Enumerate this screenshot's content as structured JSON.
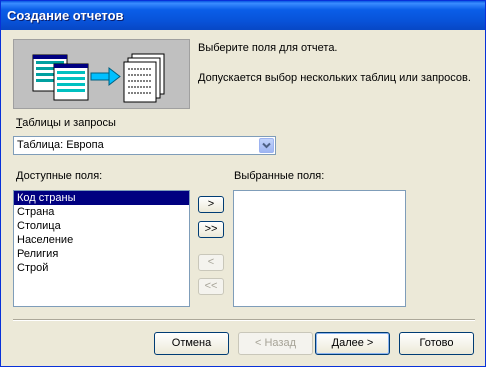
{
  "window": {
    "title": "Создание отчетов"
  },
  "intro": {
    "line1": "Выберите поля для отчета.",
    "line2": "Допускается выбор нескольких таблиц или запросов."
  },
  "tables_queries": {
    "label_mnemonic": "Т",
    "label_rest": "аблицы и запросы",
    "selected": "Таблица: Европа"
  },
  "available_fields": {
    "label_mnemonic": "Д",
    "label_rest": "оступные поля:",
    "items": [
      "Код страны",
      "Страна",
      "Столица",
      "Население",
      "Религия",
      "Строй"
    ],
    "selected_index": 0
  },
  "selected_fields": {
    "label": "Выбранные поля:",
    "items": []
  },
  "move_buttons": {
    "add_one": ">",
    "add_all": ">>",
    "remove_one": "<",
    "remove_all": "<<"
  },
  "footer": {
    "cancel": "Отмена",
    "back": "< Назад",
    "next": "Далее >",
    "finish": "Готово"
  },
  "colors": {
    "title_bar": "#0a5ee8",
    "dialog_bg": "#ece9d8",
    "selection": "#000080"
  }
}
